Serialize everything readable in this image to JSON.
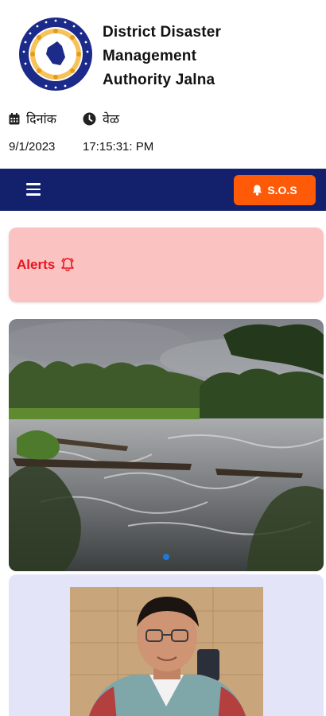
{
  "header": {
    "title_lines": [
      "District Disaster",
      "Management",
      "Authority Jalna"
    ],
    "logo": {
      "icon": "ddma-jalna-seal",
      "ring_color": "#1c2a8a"
    }
  },
  "datetime": {
    "date_label": "दिनांक",
    "time_label": "वेळ",
    "date_value": "9/1/2023",
    "time_value": "17:15:31: PM",
    "date_icon": "calendar-icon",
    "time_icon": "clock-icon"
  },
  "navbar": {
    "menu_icon": "hamburger-menu-icon",
    "sos_label": "S.O.S",
    "sos_icon": "bell-icon",
    "bg_color": "#13206b",
    "sos_color": "#fe5a08"
  },
  "alerts": {
    "label": "Alerts",
    "icon": "bell-outline-icon",
    "bg_color": "#fbc2c2",
    "text_color": "#e8151d"
  },
  "banner": {
    "image": "river-flood-photo",
    "slides": 1,
    "active_slide": 1
  },
  "officer": {
    "image": "officer-portrait-photo",
    "card_color": "#e3e4f7"
  }
}
